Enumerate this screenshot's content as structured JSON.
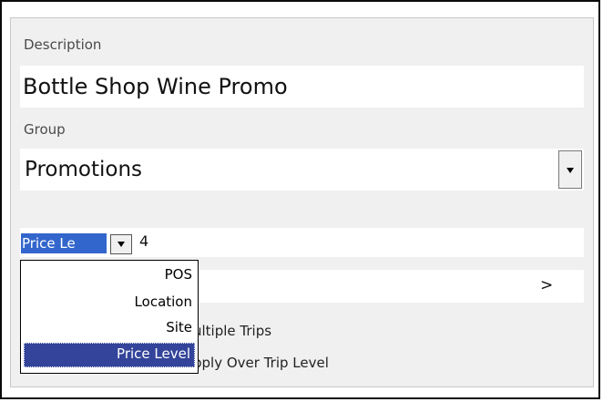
{
  "form": {
    "description_label": "Description",
    "description_value": "Bottle Shop Wine Promo",
    "group_label": "Group",
    "group_value": "Promotions",
    "price_type_value": "Price Le",
    "price_number_value": "4",
    "nav_arrow": ">",
    "multiple_trips_label_partial": "ultiple Trips",
    "apply_over_trip_partial": "pply Over Trip Level"
  },
  "dropdown": {
    "options": [
      "POS",
      "Location",
      "Site",
      "Price Level"
    ],
    "selected": "Price Level"
  },
  "colors": {
    "selection_blue": "#3366cc",
    "list_highlight": "#33449a"
  }
}
